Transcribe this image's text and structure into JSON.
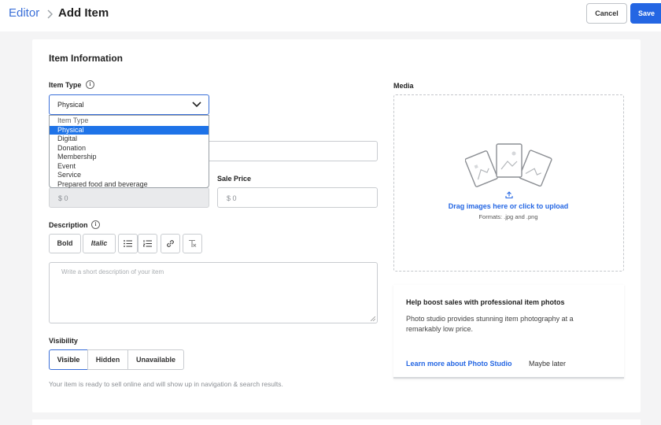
{
  "header": {
    "breadcrumb_root": "Editor",
    "page_title": "Add Item",
    "cancel_label": "Cancel",
    "save_label": "Save"
  },
  "form": {
    "section_title": "Item Information",
    "item_type": {
      "label": "Item Type",
      "selected": "Physical",
      "options": [
        "Item Type",
        "Physical",
        "Digital",
        "Donation",
        "Membership",
        "Event",
        "Service",
        "Prepared food and beverage"
      ]
    },
    "price_placeholder": "$  0",
    "sale_price": {
      "label": "Sale Price",
      "placeholder": "$  0"
    },
    "description": {
      "label": "Description",
      "toolbar": {
        "bold": "Bold",
        "italic": "Italic"
      },
      "placeholder": "Write a short description of your item"
    },
    "visibility": {
      "label": "Visibility",
      "options": [
        "Visible",
        "Hidden",
        "Unavailable"
      ],
      "selected": "Visible",
      "helper": "Your item is ready to sell online and will show up in navigation & search results."
    }
  },
  "media": {
    "label": "Media",
    "upload_text": "Drag images here or click to upload",
    "formats": "Formats: .jpg and .png"
  },
  "promo": {
    "title": "Help boost sales with professional item photos",
    "body": "Photo studio provides stunning item photography at a remarkably low price.",
    "link": "Learn more about Photo Studio",
    "dismiss": "Maybe later"
  },
  "colors": {
    "accent": "#2466e3",
    "dropdown_highlight": "#1e73e8",
    "page_bg": "#f4f4f5"
  }
}
